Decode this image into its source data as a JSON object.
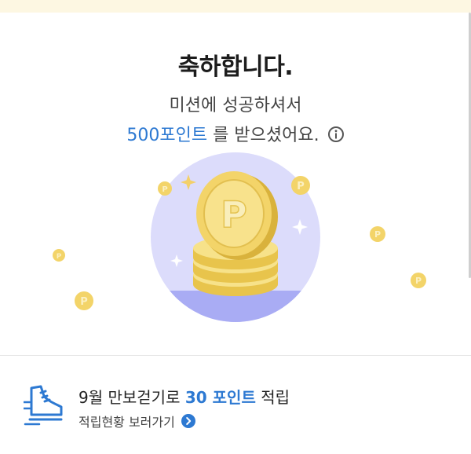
{
  "colors": {
    "accent": "#2d79d2",
    "banner": "#fdf7e2",
    "coin": "#f4d86a",
    "circle_bg": "#dcdcfb",
    "circle_floor": "#a9acf4"
  },
  "reward": {
    "title": "축하합니다.",
    "line1": "미션에 성공하셔서",
    "points_text": "500포인트",
    "line2_rest": " 를 받으셨어요.",
    "info_icon": "info-icon",
    "coin_letter": "P"
  },
  "walk": {
    "prefix": "9월 만보걷기로 ",
    "points": "30 포인트",
    "suffix": " 적립",
    "link_label": "적립현황 보러가기",
    "icon": "sneaker-icon",
    "link_icon": "chevron-right-icon"
  }
}
